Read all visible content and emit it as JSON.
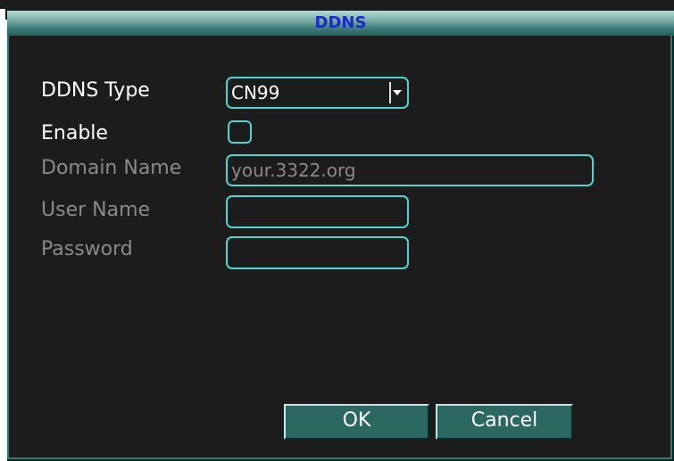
{
  "dialog": {
    "title": "DDNS"
  },
  "form": {
    "ddns_type": {
      "label": "DDNS Type",
      "value": "CN99"
    },
    "enable": {
      "label": "Enable",
      "checked": false
    },
    "domain_name": {
      "label": "Domain Name",
      "value": "your.3322.org"
    },
    "user_name": {
      "label": "User Name",
      "value": ""
    },
    "password": {
      "label": "Password",
      "value": ""
    }
  },
  "buttons": {
    "ok_label": "OK",
    "cancel_label": "Cancel"
  },
  "colors": {
    "background": "#1c1c1c",
    "accent": "#4fd4d1",
    "title_text": "#1a2cc8",
    "disabled_text": "#8a8a8a",
    "button_face": "#2c6862"
  },
  "icons": {
    "dropdown": "chevron-down-icon"
  }
}
